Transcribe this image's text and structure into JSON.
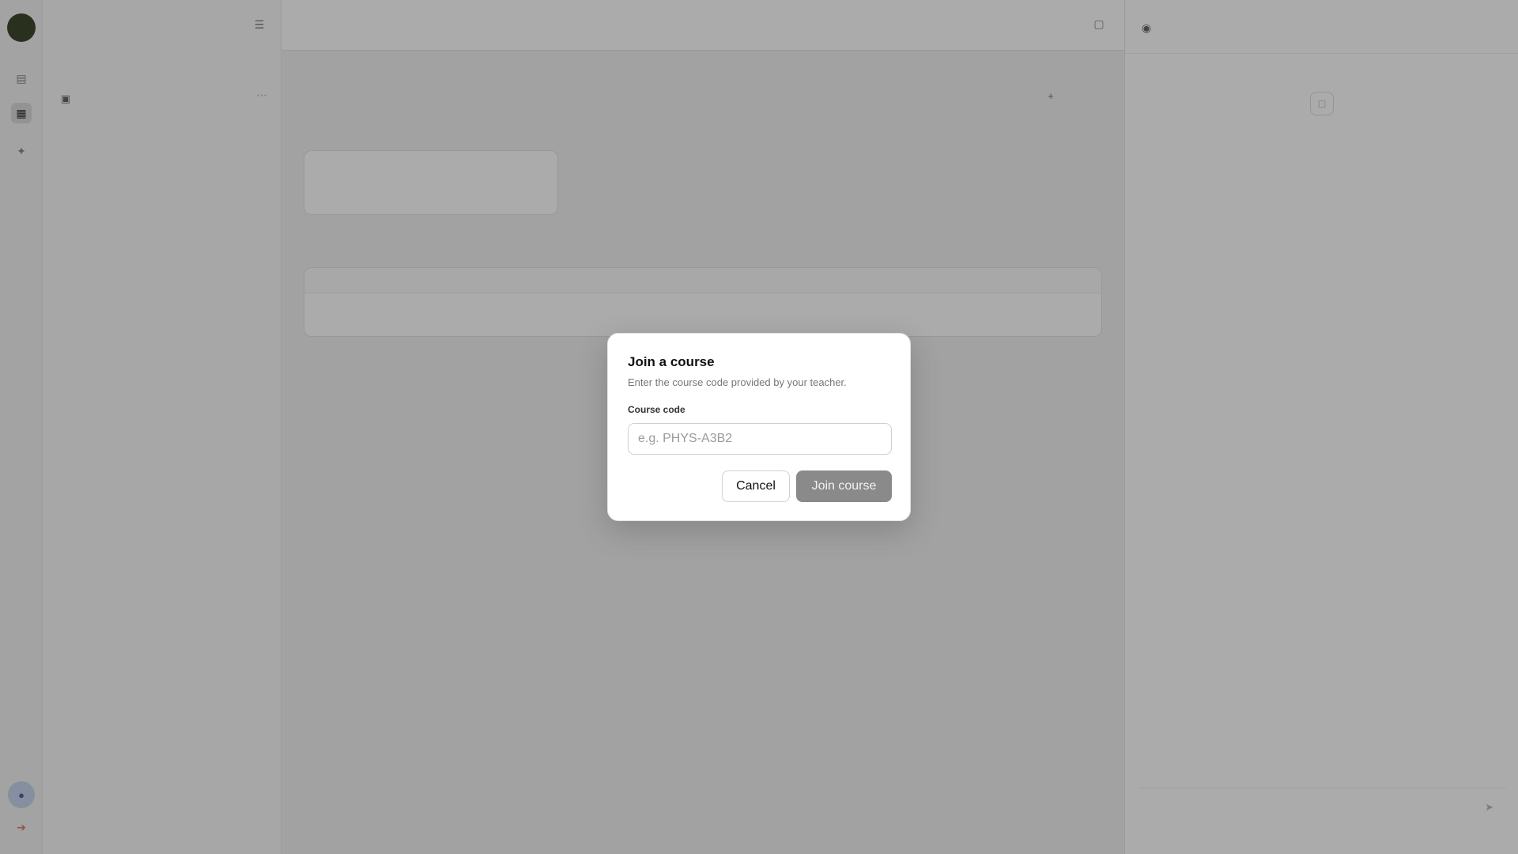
{
  "rail": {
    "top_icon": "book-icon",
    "active_icon": "grid-icon",
    "lower_icon": "sparkle-icon",
    "user_icon": "user-icon",
    "bottom_icon": "logout-icon"
  },
  "sidebar": {
    "eyebrow": "",
    "title": "",
    "subtitle": "",
    "items": [
      {
        "title": "",
        "description": ""
      }
    ],
    "footer": ""
  },
  "main": {
    "header_title": "",
    "header_sub": "",
    "page_eyebrow": "",
    "page_title": "",
    "page_action": "",
    "course_card": {
      "title": "",
      "description": ""
    },
    "section_label": "",
    "activity": {
      "head": "",
      "title": "",
      "sub": "",
      "status": ""
    }
  },
  "right_panel": {
    "title": "",
    "sub": "",
    "empty_text": "",
    "input_placeholder": "",
    "disclaimer": ""
  },
  "dialog": {
    "title": "Join a course",
    "description": "Enter the course code provided by your teacher.",
    "field_label": "Course code",
    "field_value": "",
    "field_placeholder": "e.g. PHYS-A3B2",
    "cancel_label": "Cancel",
    "submit_label": "Join course",
    "submit_color": "#8a8a8a"
  },
  "colors": {
    "overlay": "rgba(0,0,0,0.33)",
    "rail_avatar": "#3e4a2e",
    "rail_user": "#c6d6ee",
    "rail_alert": "#e07a6a"
  }
}
